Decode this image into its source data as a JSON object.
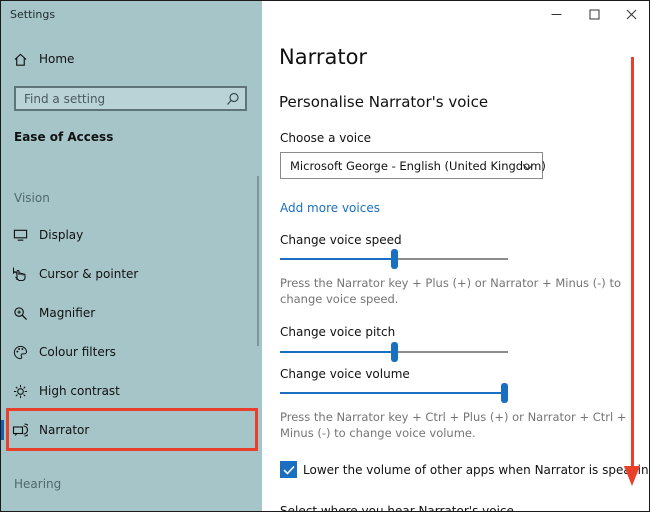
{
  "window": {
    "title": "Settings"
  },
  "sidebar": {
    "home_label": "Home",
    "search_placeholder": "Find a setting",
    "section": "Ease of Access",
    "groups": {
      "vision": "Vision",
      "hearing": "Hearing"
    },
    "items": [
      {
        "label": "Display",
        "icon": "monitor-icon"
      },
      {
        "label": "Cursor & pointer",
        "icon": "cursor-pointer-icon"
      },
      {
        "label": "Magnifier",
        "icon": "magnifier-icon"
      },
      {
        "label": "Colour filters",
        "icon": "colour-filters-icon"
      },
      {
        "label": "High contrast",
        "icon": "high-contrast-icon"
      },
      {
        "label": "Narrator",
        "icon": "narrator-icon",
        "selected": true
      }
    ]
  },
  "main": {
    "title": "Narrator",
    "subtitle": "Personalise Narrator's voice",
    "choose_voice_label": "Choose a voice",
    "voice_value": "Microsoft George - English (United Kingdom)",
    "add_voices_link": "Add more voices",
    "speed": {
      "label": "Change voice speed",
      "level": 0.5
    },
    "speed_help": "Press the Narrator key + Plus (+) or Narrator + Minus (-) to change voice speed.",
    "pitch": {
      "label": "Change voice pitch",
      "level": 0.5
    },
    "volume": {
      "label": "Change voice volume",
      "level": 1.0
    },
    "volume_help": "Press the Narrator key + Ctrl + Plus (+) or Narrator + Ctrl + Minus (-) to change voice volume.",
    "lower_volume_label": "Lower the volume of other apps when Narrator is speaking",
    "lower_volume_checked": true,
    "next_section_label": "Select where you hear Narrator's voice"
  },
  "colors": {
    "sidebar_bg": "#a6c5c9",
    "accent": "#1a6fc0",
    "annotation": "#e8402a"
  }
}
